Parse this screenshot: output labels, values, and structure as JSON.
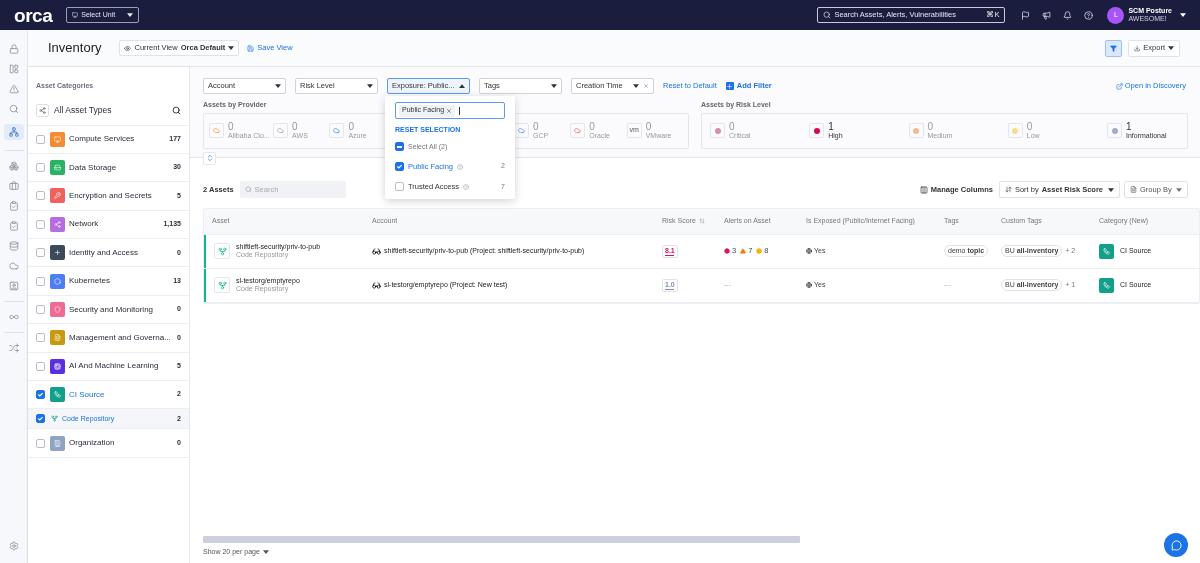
{
  "topbar": {
    "logo": "orca",
    "unit_select": "Select Unit",
    "search": {
      "placeholder": "Search Assets, Alerts, Vulnerabilities",
      "shortcut": "⌘K"
    },
    "user": {
      "initial": "L",
      "name": "SCM Posture",
      "org": "AWESOME!"
    }
  },
  "header": {
    "title": "Inventory",
    "view_label": "Current View",
    "view_name": "Orca Default",
    "save_view": "Save View",
    "export": "Export"
  },
  "sidebar": {
    "title": "Asset Categories",
    "all_label": "All Asset Types",
    "categories": [
      {
        "name": "Compute Services",
        "count": "177",
        "color": "#f68b32",
        "checked": false
      },
      {
        "name": "Data Storage",
        "count": "30",
        "color": "#28b463",
        "checked": false
      },
      {
        "name": "Encryption and Secrets",
        "count": "5",
        "color": "#f0605d",
        "checked": false
      },
      {
        "name": "Network",
        "count": "1,135",
        "color": "#b86ae0",
        "checked": false
      },
      {
        "name": "Identity and Access",
        "count": "0",
        "color": "#3b4a5a",
        "checked": false
      },
      {
        "name": "Kubernetes",
        "count": "13",
        "color": "#4d7ef7",
        "checked": false
      },
      {
        "name": "Security and Monitoring",
        "count": "0",
        "color": "#f06a95",
        "checked": false
      },
      {
        "name": "Management and Governa...",
        "count": "0",
        "color": "#c9980b",
        "checked": false
      },
      {
        "name": "AI And Machine Learning",
        "count": "5",
        "color": "#5b2ee0",
        "checked": false
      },
      {
        "name": "CI Source",
        "count": "2",
        "color": "#12a08a",
        "checked": true,
        "children": [
          {
            "name": "Code Repository",
            "count": "2",
            "checked": true
          }
        ]
      },
      {
        "name": "Organization",
        "count": "0",
        "color": "#8fa4c2",
        "checked": false
      }
    ]
  },
  "filters": [
    {
      "label": "Account",
      "open": false,
      "clearable": false
    },
    {
      "label": "Risk Level",
      "open": false,
      "clearable": false
    },
    {
      "label": "Exposure: Public...",
      "open": true,
      "clearable": false
    },
    {
      "label": "Tags",
      "open": false,
      "clearable": false
    },
    {
      "label": "Creation Time",
      "open": false,
      "clearable": true
    }
  ],
  "reset_default": "Reset to Default",
  "add_filter": "Add Filter",
  "open_discovery": "Open in Discovery",
  "exposure_dropdown": {
    "chip": "Public Facing",
    "reset": "RESET SELECTION",
    "select_all": {
      "label": "Select All (2)",
      "indeterminate": true
    },
    "options": [
      {
        "label": "Public Facing",
        "count": "2",
        "checked": true
      },
      {
        "label": "Trusted Access",
        "count": "7",
        "checked": false
      }
    ]
  },
  "providers": {
    "title": "Assets by Provider",
    "items": [
      {
        "value": "0",
        "name": "Alibaba Clo..."
      },
      {
        "value": "0",
        "name": "AWS"
      },
      {
        "value": "0",
        "name": "Azure"
      },
      {
        "value": "0",
        "name": "GCP"
      },
      {
        "value": "0",
        "name": "Oracle"
      },
      {
        "value": "0",
        "name": "VMware",
        "abbr": "vm"
      }
    ]
  },
  "risk_levels": {
    "title": "Assets by Risk Level",
    "items": [
      {
        "value": "1",
        "name": "High",
        "color": "#d6094f",
        "highlighted": true
      },
      {
        "value": "0",
        "name": "Medium",
        "color": "#f6b98e",
        "highlighted": false
      },
      {
        "value": "0",
        "name": "Low",
        "color": "#f5dc8c",
        "highlighted": false
      },
      {
        "value": "1",
        "name": "Informational",
        "color": "#a3abc7",
        "highlighted": true
      }
    ],
    "first": {
      "value": "0",
      "name": "Critical",
      "color": "#d88fa3",
      "highlighted": false
    }
  },
  "table_toolbar": {
    "count": "2 Assets",
    "search_placeholder": "Search",
    "manage_columns": "Manage Columns",
    "sort_label": "Sort by",
    "sort_value": "Asset Risk Score",
    "group_by": "Group By"
  },
  "table": {
    "columns": [
      "Asset",
      "Account",
      "Risk Score",
      "Alerts on Asset",
      "Is Exposed (Public/Internet Facing)",
      "Tags",
      "Custom Tags",
      "Category (New)"
    ],
    "rows": [
      {
        "asset": "shiftleft-security/priv-to-pub",
        "type": "Code Repository",
        "account": "shiftleft-security/priv-to-pub (Project: shiftleft-security/priv-to-pub)",
        "risk": {
          "score": "8.1",
          "color": "#e0115f"
        },
        "alerts": [
          {
            "kind": "critical",
            "count": "3"
          },
          {
            "kind": "high",
            "count": "7"
          },
          {
            "kind": "medium",
            "count": "8"
          }
        ],
        "exposed": "Yes",
        "tags": [
          {
            "key": "demo",
            "value": "topic"
          }
        ],
        "custom_tag": {
          "key": "BU",
          "value": "all-inventory"
        },
        "custom_more": "+ 2",
        "category": "CI Source"
      },
      {
        "asset": "sl-testorg/emptyrepo",
        "type": "Code Repository",
        "account": "sl-testorg/emptyrepo (Project: New test)",
        "risk": {
          "score": "1.0",
          "color": "#7f8fb8"
        },
        "alerts_empty": "---",
        "exposed": "Yes",
        "tags_empty": "---",
        "custom_tag": {
          "key": "BU",
          "value": "all-inventory"
        },
        "custom_more": "+ 1",
        "category": "CI Source"
      }
    ]
  },
  "pagination": "Show 20 per page"
}
